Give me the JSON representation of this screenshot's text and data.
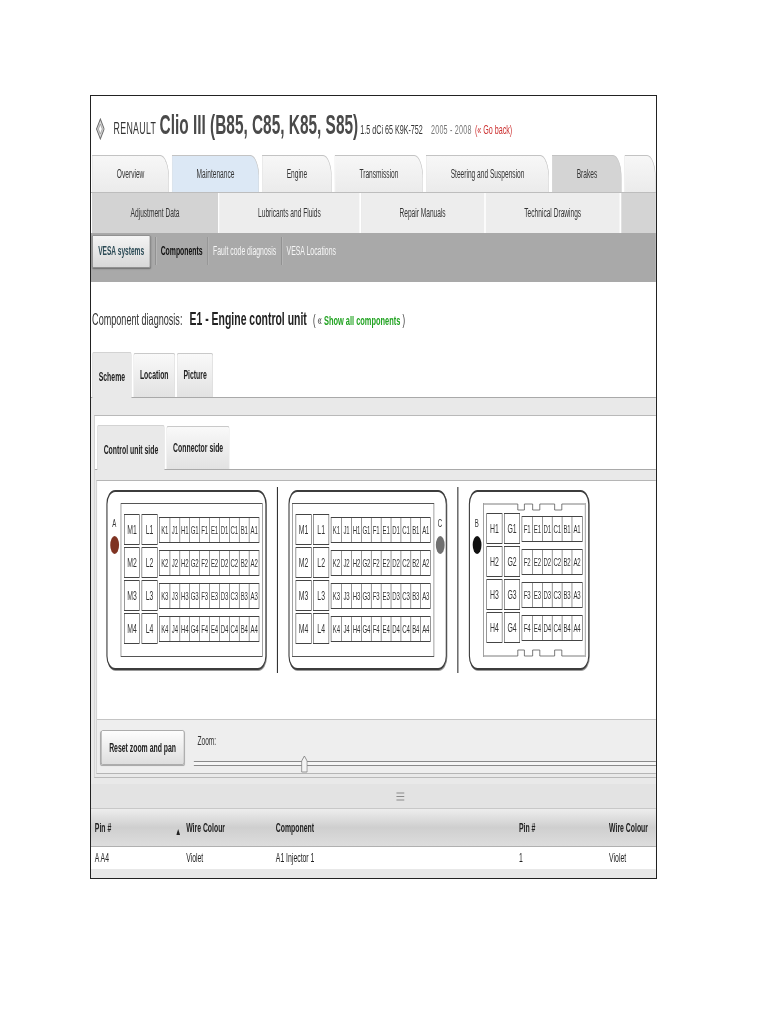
{
  "header": {
    "brand": "RENAULT",
    "model": "Clio III (B85, C85, K85, S85)",
    "engine": "1.5 dCi 65 K9K-752",
    "years": "2005 - 2008",
    "back_link": "(« Go back)"
  },
  "main_tabs": [
    {
      "label": "Overview",
      "selected": false,
      "highlighted": false
    },
    {
      "label": "Maintenance",
      "selected": true,
      "highlighted": false
    },
    {
      "label": "Engine",
      "selected": false,
      "highlighted": false
    },
    {
      "label": "Transmission",
      "selected": false,
      "highlighted": false
    },
    {
      "label": "Steering and Suspension",
      "selected": false,
      "highlighted": false
    },
    {
      "label": "Brakes",
      "selected": false,
      "highlighted": true
    }
  ],
  "sub_tabs": [
    {
      "label": "Adjustment Data",
      "selected": true
    },
    {
      "label": "Lubricants and Fluids",
      "selected": false
    },
    {
      "label": "Repair Manuals",
      "selected": false
    },
    {
      "label": "Technical Drawings",
      "selected": false
    }
  ],
  "nav": [
    {
      "label": "VESA systems",
      "kind": "button",
      "selected": true
    },
    {
      "label": "Components",
      "kind": "link",
      "selected": true
    },
    {
      "label": "Fault code diagnosis",
      "kind": "link",
      "selected": false
    },
    {
      "label": "VESA Locations",
      "kind": "link",
      "selected": false
    }
  ],
  "diagnosis": {
    "label": "Component diagnosis:",
    "component": "E1 - Engine control unit",
    "prefix": "( «",
    "link": "Show all components",
    "suffix": ")"
  },
  "view_tabs": [
    {
      "label": "Scheme",
      "selected": true
    },
    {
      "label": "Location",
      "selected": false
    },
    {
      "label": "Picture",
      "selected": false
    }
  ],
  "side_tabs": [
    {
      "label": "Control unit side",
      "selected": true
    },
    {
      "label": "Connector side",
      "selected": false
    }
  ],
  "connectors": [
    {
      "letter": "A",
      "color": "#7f3322",
      "marker_right": false,
      "notched": false,
      "rows": [
        {
          "wide": [
            "M1",
            "L1"
          ],
          "narrow": [
            "K1",
            "J1",
            "H1",
            "G1",
            "F1",
            "E1",
            "D1",
            "C1",
            "B1",
            "A1"
          ]
        },
        {
          "wide": [
            "M2",
            "L2"
          ],
          "narrow": [
            "K2",
            "J2",
            "H2",
            "G2",
            "F2",
            "E2",
            "D2",
            "C2",
            "B2",
            "A2"
          ]
        },
        {
          "wide": [
            "M3",
            "L3"
          ],
          "narrow": [
            "K3",
            "J3",
            "H3",
            "G3",
            "F3",
            "E3",
            "D3",
            "C3",
            "B3",
            "A3"
          ]
        },
        {
          "wide": [
            "M4",
            "L4"
          ],
          "narrow": [
            "K4",
            "J4",
            "H4",
            "G4",
            "F4",
            "E4",
            "D4",
            "C4",
            "B4",
            "A4"
          ]
        }
      ]
    },
    {
      "letter": "C",
      "color": "#707070",
      "marker_right": true,
      "notched": false,
      "rows": [
        {
          "wide": [
            "M1",
            "L1"
          ],
          "narrow": [
            "K1",
            "J1",
            "H1",
            "G1",
            "F1",
            "E1",
            "D1",
            "C1",
            "B1",
            "A1"
          ]
        },
        {
          "wide": [
            "M2",
            "L2"
          ],
          "narrow": [
            "K2",
            "J2",
            "H2",
            "G2",
            "F2",
            "E2",
            "D2",
            "C2",
            "B2",
            "A2"
          ]
        },
        {
          "wide": [
            "M3",
            "L3"
          ],
          "narrow": [
            "K3",
            "J3",
            "H3",
            "G3",
            "F3",
            "E3",
            "D3",
            "C3",
            "B3",
            "A3"
          ]
        },
        {
          "wide": [
            "M4",
            "L4"
          ],
          "narrow": [
            "K4",
            "J4",
            "H4",
            "G4",
            "F4",
            "E4",
            "D4",
            "C4",
            "B4",
            "A4"
          ]
        }
      ]
    },
    {
      "letter": "B",
      "color": "#111111",
      "marker_right": false,
      "notched": true,
      "rows": [
        {
          "wide": [
            "H1",
            "G1"
          ],
          "narrow": [
            "F1",
            "E1",
            "D1",
            "C1",
            "B1",
            "A1"
          ]
        },
        {
          "wide": [
            "H2",
            "G2"
          ],
          "narrow": [
            "F2",
            "E2",
            "D2",
            "C2",
            "B2",
            "A2"
          ]
        },
        {
          "wide": [
            "H3",
            "G3"
          ],
          "narrow": [
            "F3",
            "E3",
            "D3",
            "C3",
            "B3",
            "A3"
          ]
        },
        {
          "wide": [
            "H4",
            "G4"
          ],
          "narrow": [
            "F4",
            "E4",
            "D4",
            "C4",
            "B4",
            "A4"
          ]
        }
      ]
    }
  ],
  "zoom": {
    "button": "Reset zoom and pan",
    "label": "Zoom:",
    "level": 0.24
  },
  "table": {
    "columns": [
      {
        "label": "Pin #",
        "sorted": true
      },
      {
        "label": "Wire Colour",
        "sorted": false
      },
      {
        "label": "Component",
        "sorted": false
      },
      {
        "label": "Pin #",
        "sorted": false
      },
      {
        "label": "Wire Colour",
        "sorted": false
      }
    ],
    "rows": [
      [
        "A A4",
        "Violet",
        "A1 Injector 1",
        "1",
        "Violet"
      ]
    ]
  }
}
